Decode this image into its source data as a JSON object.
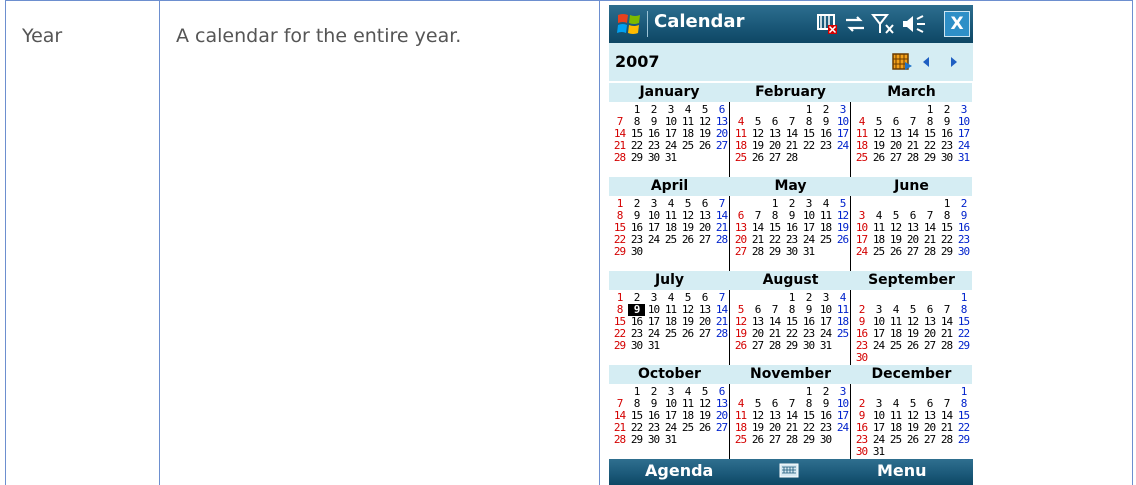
{
  "table": {
    "label": "Year",
    "description": "A calendar for the entire year."
  },
  "phone": {
    "title": "Calendar",
    "status_icons": [
      "calendar-alarm-icon",
      "sync-icon",
      "signal-off-icon",
      "volume-icon"
    ],
    "close_label": "X",
    "year": "2007",
    "softkeys": {
      "left": "Agenda",
      "right": "Menu"
    },
    "today": {
      "month": 6,
      "day": 9
    },
    "months": [
      {
        "name": "January",
        "start": 1,
        "days": 31
      },
      {
        "name": "February",
        "start": 4,
        "days": 28
      },
      {
        "name": "March",
        "start": 4,
        "days": 31
      },
      {
        "name": "April",
        "start": 0,
        "days": 30
      },
      {
        "name": "May",
        "start": 2,
        "days": 31
      },
      {
        "name": "June",
        "start": 5,
        "days": 30
      },
      {
        "name": "July",
        "start": 0,
        "days": 31
      },
      {
        "name": "August",
        "start": 3,
        "days": 31
      },
      {
        "name": "September",
        "start": 6,
        "days": 30
      },
      {
        "name": "October",
        "start": 1,
        "days": 31
      },
      {
        "name": "November",
        "start": 4,
        "days": 30
      },
      {
        "name": "December",
        "start": 6,
        "days": 31
      }
    ],
    "colors": {
      "sunday": "#d40000",
      "saturday": "#0022cc",
      "header_bg": "#d5edf3",
      "bar": "#1a5878"
    }
  }
}
